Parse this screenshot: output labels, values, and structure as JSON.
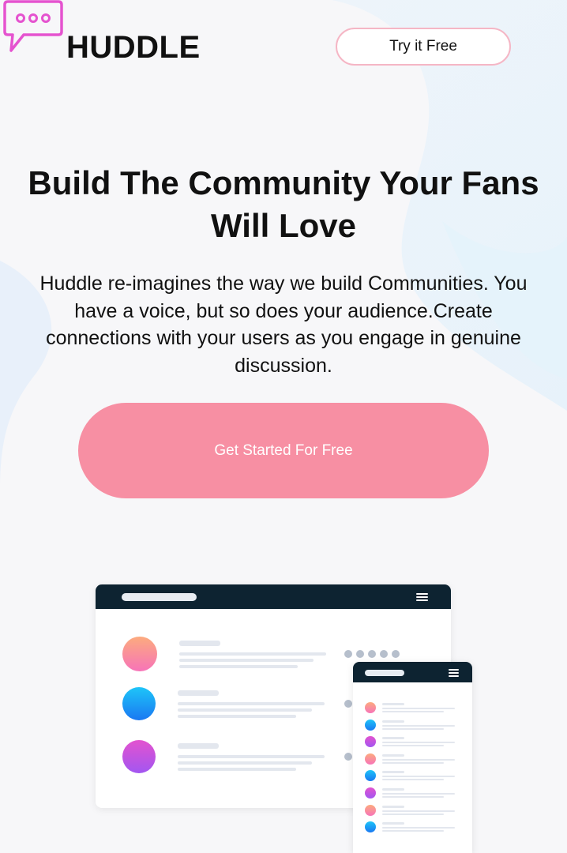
{
  "brand": {
    "name": "HUDDLE",
    "icon": "chat-bubble-icon"
  },
  "nav": {
    "try_label": "Try it Free"
  },
  "hero": {
    "title_line1": "Build The Community Your Fans",
    "title_line2": "Will Love",
    "text_lines": [
      "Huddle re-imagines the way we build Communities. You",
      "have a voice, but so does your audience.Create",
      "connections with your users as you engage in genuine",
      "discussion."
    ],
    "cta_label": "Get Started For Free"
  },
  "mockup": {
    "desktop_avatar_colors": [
      [
        "#fcab7e",
        "#f774b8"
      ],
      [
        "#1ec5f8",
        "#1a78f2"
      ],
      [
        "#e353cf",
        "#a256f1"
      ]
    ],
    "phone_avatar_colors": [
      [
        "#fcab7e",
        "#f774b8"
      ],
      [
        "#1ec5f8",
        "#1a78f2"
      ],
      [
        "#e353cf",
        "#a256f1"
      ],
      [
        "#fcab7e",
        "#f774b8"
      ],
      [
        "#1ec5f8",
        "#1a78f2"
      ],
      [
        "#e353cf",
        "#a256f1"
      ],
      [
        "#fcab7e",
        "#f774b8"
      ],
      [
        "#1ec5f8",
        "#1a78f2"
      ]
    ],
    "menu_icon": "hamburger-menu-icon"
  },
  "colors": {
    "accent_pink": "#f78fa3",
    "dark_bar": "#0d2331",
    "background": "#f7f7f9"
  }
}
